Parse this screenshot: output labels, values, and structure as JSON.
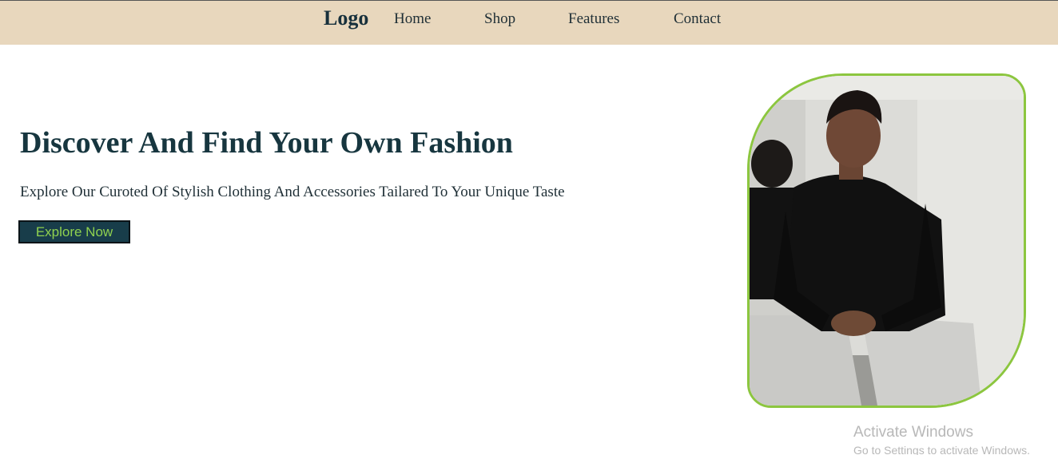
{
  "nav": {
    "logo": "Logo",
    "links": [
      "Home",
      "Shop",
      "Features",
      "Contact"
    ]
  },
  "hero": {
    "title": "Discover And Find Your Own Fashion",
    "subtitle": "Explore Our Curoted Of Stylish Clothing And Accessories Tailared To Your Unique Taste",
    "cta_label": "Explore Now",
    "image_description": "photo of a man in a black shirt seated in a fitting room"
  },
  "watermark": {
    "title": "Activate Windows",
    "subtitle": "Go to Settings to activate Windows."
  },
  "colors": {
    "header_bg": "#e8d7bd",
    "heading": "#17363f",
    "cta_bg": "#183d4a",
    "cta_text": "#8fd14f",
    "image_border": "#8cc63f"
  }
}
